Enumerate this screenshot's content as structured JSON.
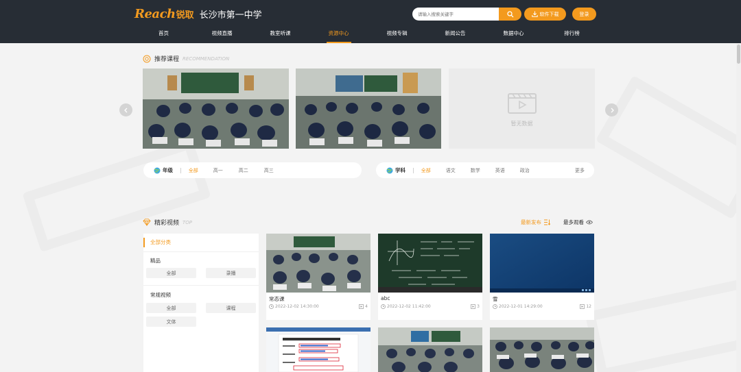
{
  "header": {
    "logo_mark": "Reach",
    "logo_cn": "锐取",
    "site_title": "长沙市第一中学",
    "search_placeholder": "请输入搜索关键字",
    "download_label": "软件下载",
    "login_label": "登录",
    "nav": [
      {
        "label": "首页",
        "active": false
      },
      {
        "label": "视频直播",
        "active": false
      },
      {
        "label": "教室听课",
        "active": false
      },
      {
        "label": "资源中心",
        "active": true
      },
      {
        "label": "视频专辑",
        "active": false
      },
      {
        "label": "新闻公告",
        "active": false
      },
      {
        "label": "数据中心",
        "active": false
      },
      {
        "label": "排行榜",
        "active": false
      }
    ]
  },
  "recommend": {
    "title": "推荐课程",
    "subtitle": "RECOMMENDATION",
    "empty_text": "暂无数据"
  },
  "filters": {
    "grade": {
      "label": "年级",
      "options": [
        "全部",
        "高一",
        "高二",
        "高三"
      ]
    },
    "subject": {
      "label": "学科",
      "options": [
        "全部",
        "语文",
        "数学",
        "英语",
        "政治"
      ],
      "more": "更多"
    }
  },
  "featured": {
    "title": "精彩视频",
    "subtitle": "TOP",
    "sort_latest": "最新发布",
    "sort_most_viewed": "最多观看",
    "sidebar": {
      "all_categories": "全部分类",
      "group1": "精品",
      "group1_tags": [
        "全部",
        "录播"
      ],
      "group2": "常规视频",
      "group2_tags": [
        "全部",
        "课程",
        "文体"
      ]
    },
    "videos": [
      {
        "title": "常态课",
        "date": "2022-12-02 14:30:00",
        "count": "4"
      },
      {
        "title": "abc",
        "date": "2022-12-02 11:42:00",
        "count": "3"
      },
      {
        "title": "雪",
        "date": "2022-12-01 14:29:00",
        "count": "12"
      }
    ]
  },
  "colors": {
    "accent": "#f39a1e",
    "header_bg": "#272d35",
    "page_bg": "#f3f3f3"
  }
}
